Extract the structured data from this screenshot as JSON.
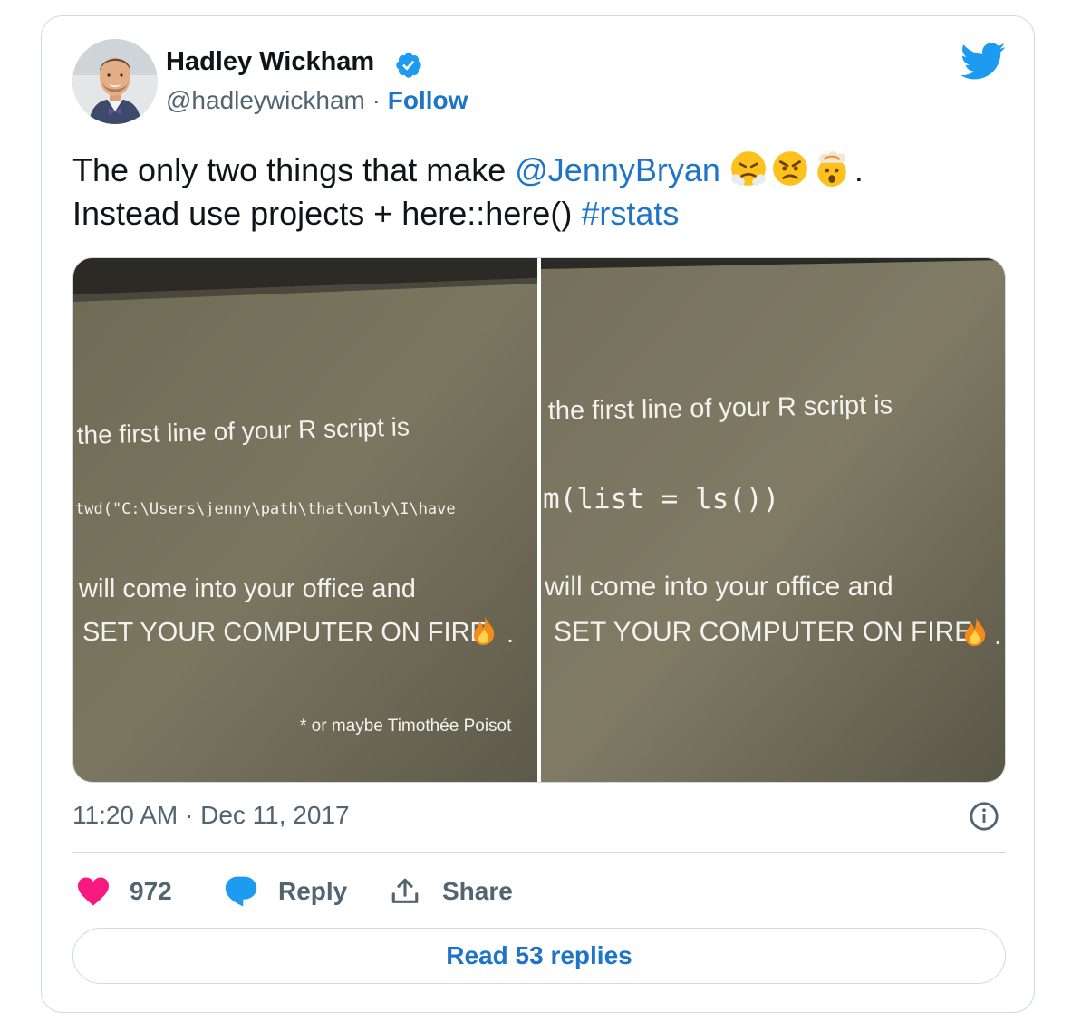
{
  "author": {
    "display_name": "Hadley Wickham",
    "handle": "@hadleywickham",
    "separator": "·",
    "follow_label": "Follow"
  },
  "tweet": {
    "text_part1": "The only two things that make ",
    "mention": "@JennyBryan",
    "period": ".",
    "text_line2": "Instead use projects + here::here() ",
    "hashtag": "#rstats",
    "emojis": [
      "face-with-steam-icon",
      "angry-face-icon",
      "exploding-head-icon"
    ]
  },
  "images": {
    "left": {
      "line1": "the first line of your R script is",
      "code": "twd(\"C:\\Users\\jenny\\path\\that\\only\\I\\have",
      "line2": "will come into your office and",
      "line3": "SET YOUR COMPUTER ON FIRE",
      "footnote": "* or maybe Timothée Poisot"
    },
    "right": {
      "line1": "the first line of your R script is",
      "code": "m(list = ls())",
      "line2": "will come into your office and",
      "line3": "SET YOUR COMPUTER ON FIRE"
    },
    "fire_icon": "fire-icon"
  },
  "meta": {
    "timestamp": "11:20 AM · Dec 11, 2017"
  },
  "actions": {
    "like_count": "972",
    "reply_label": "Reply",
    "share_label": "Share"
  },
  "replies_button": "Read 53 replies",
  "colors": {
    "link": "#1d74c9",
    "like": "#f91880",
    "reply": "#1d9bf0",
    "twitter_brand": "#1d9bf0",
    "muted": "#536471",
    "border": "#cfd9de"
  }
}
